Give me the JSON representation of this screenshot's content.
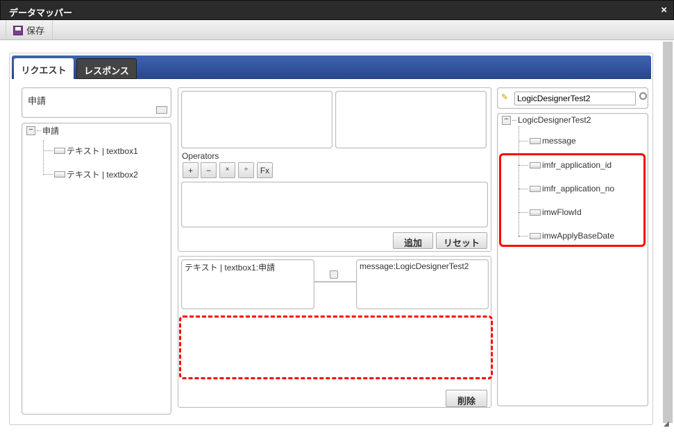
{
  "window": {
    "title": "データマッパー",
    "close_icon": "×"
  },
  "toolbar": {
    "save_label": "保存"
  },
  "tabs": [
    {
      "label": "リクエスト",
      "active": true
    },
    {
      "label": "レスポンス",
      "active": false
    }
  ],
  "left": {
    "form_title": "申請",
    "tree": {
      "root": "申請",
      "items": [
        "テキスト | textbox1",
        "テキスト | textbox2"
      ]
    }
  },
  "middle": {
    "operators_label": "Operators",
    "operators": [
      "+",
      "−",
      "×",
      "÷",
      "Fx"
    ],
    "add_label": "追加",
    "reset_label": "リセット",
    "mapping": {
      "source": "テキスト | textbox1:申請",
      "target": "message:LogicDesignerTest2"
    },
    "delete_label": "削除"
  },
  "right": {
    "search_value": "LogicDesignerTest2",
    "tree": {
      "root": "LogicDesignerTest2",
      "items": [
        "message",
        "imfr_application_id",
        "imfr_application_no",
        "imwFlowId",
        "imwApplyBaseDate"
      ]
    }
  },
  "colors": {
    "highlight": "#ff0000",
    "tabbar": "#2f4f98"
  }
}
